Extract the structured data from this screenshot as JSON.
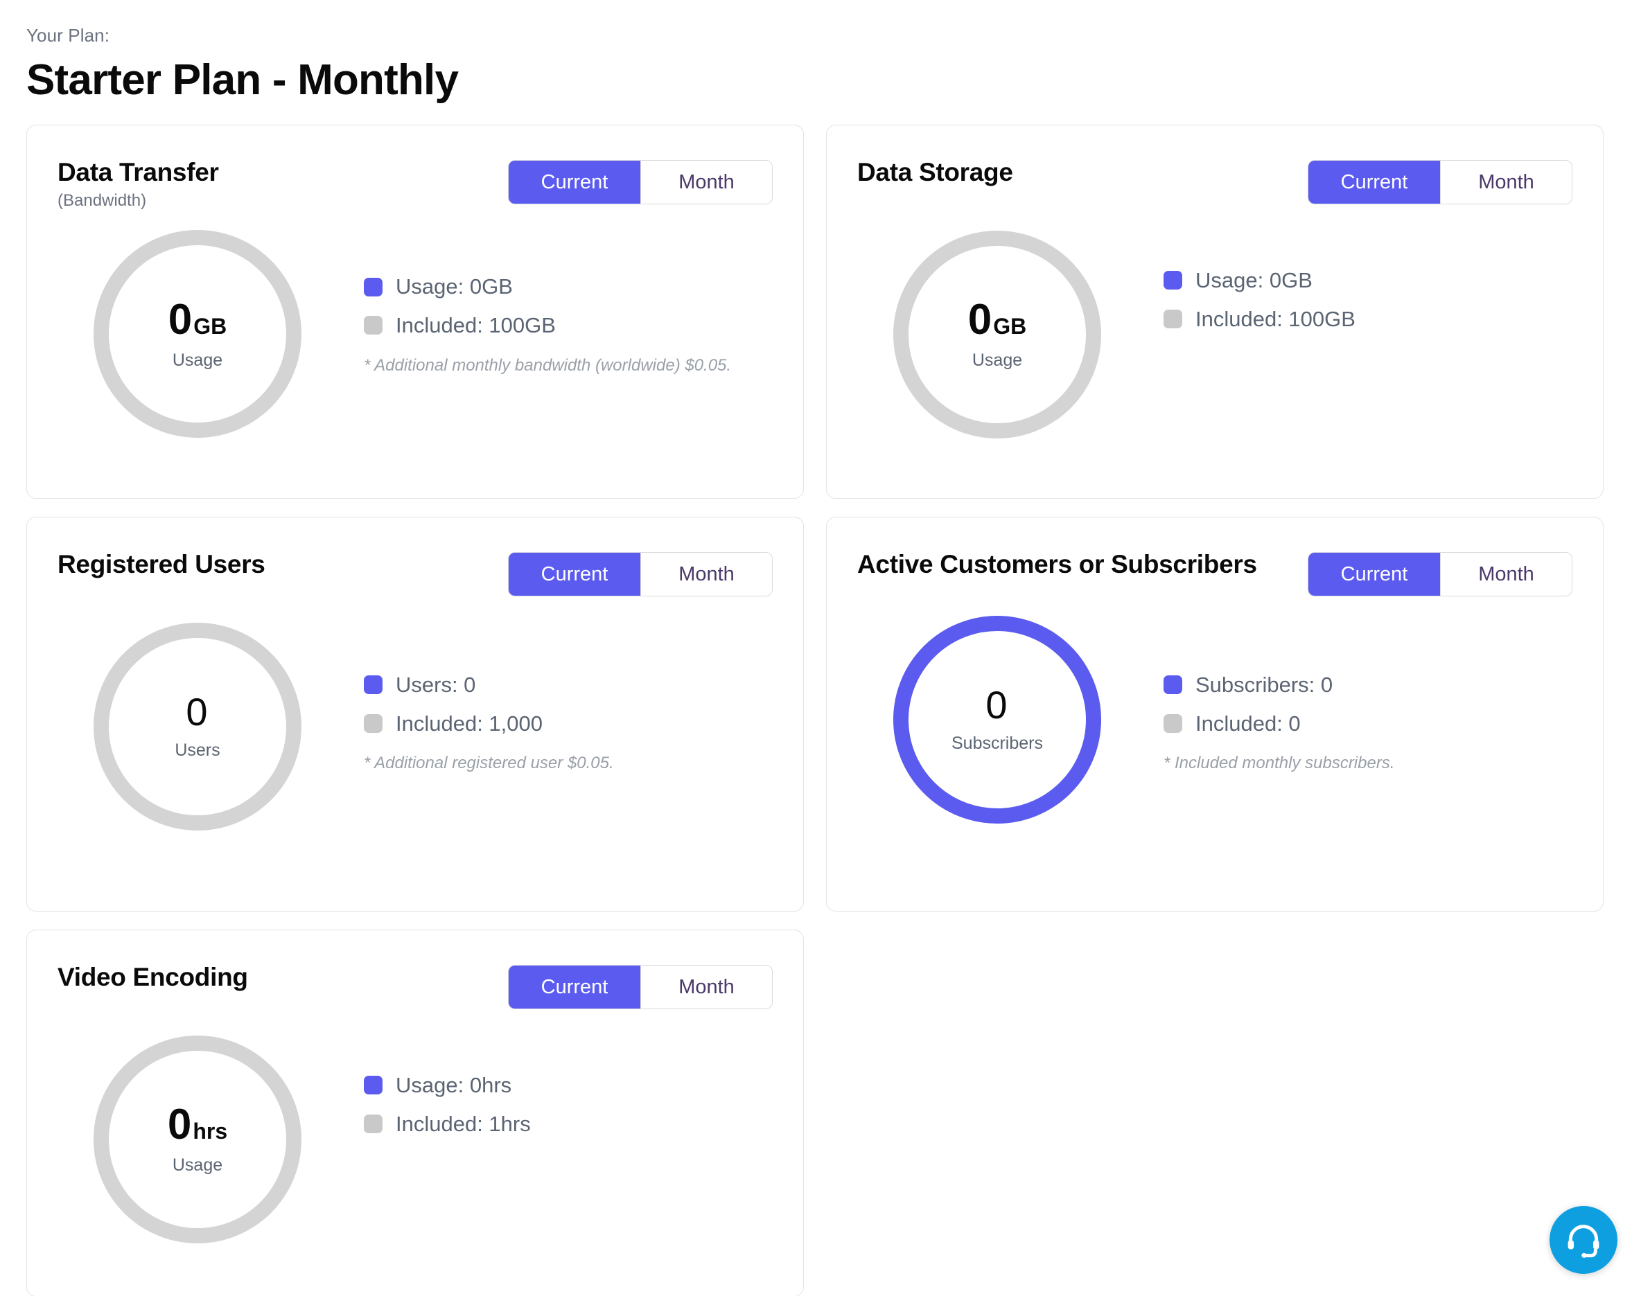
{
  "header": {
    "eyebrow": "Your Plan:",
    "title": "Starter Plan - Monthly"
  },
  "toggle": {
    "current_label": "Current",
    "month_label": "Month"
  },
  "colors": {
    "accent_purple": "#5B5BEF",
    "ring_gray": "#D4D4D4",
    "swatch_gray": "#C9C9C9",
    "support_blue": "#0E9FE0",
    "muted_text": "#5B6472",
    "note_text": "#9AA0A8"
  },
  "cards": [
    {
      "id": "data-transfer",
      "title": "Data Transfer",
      "subtitle": "(Bandwidth)",
      "donut": {
        "value": "0",
        "unit": "GB",
        "label": "Usage",
        "ring_color": "#D4D4D4",
        "percent": 0
      },
      "legend": [
        {
          "swatch": "purple",
          "text": "Usage: 0GB"
        },
        {
          "swatch": "gray",
          "text": "Included: 100GB"
        }
      ],
      "note": "* Additional monthly bandwidth (worldwide) $0.05."
    },
    {
      "id": "data-storage",
      "title": "Data Storage",
      "subtitle": "",
      "donut": {
        "value": "0",
        "unit": "GB",
        "label": "Usage",
        "ring_color": "#D4D4D4",
        "percent": 0
      },
      "legend": [
        {
          "swatch": "purple",
          "text": "Usage: 0GB"
        },
        {
          "swatch": "gray",
          "text": "Included: 100GB"
        }
      ],
      "note": ""
    },
    {
      "id": "registered-users",
      "title": "Registered Users",
      "subtitle": "",
      "donut": {
        "value": "0",
        "unit": "",
        "label": "Users",
        "ring_color": "#D4D4D4",
        "percent": 0
      },
      "legend": [
        {
          "swatch": "purple",
          "text": "Users: 0"
        },
        {
          "swatch": "gray",
          "text": "Included: 1,000"
        }
      ],
      "note": "* Additional registered user $0.05."
    },
    {
      "id": "active-subscribers",
      "title": "Active Customers or Subscribers",
      "subtitle": "",
      "donut": {
        "value": "0",
        "unit": "",
        "label": "Subscribers",
        "ring_color": "#5B5BEF",
        "percent": 100
      },
      "legend": [
        {
          "swatch": "purple",
          "text": "Subscribers: 0"
        },
        {
          "swatch": "gray",
          "text": "Included: 0"
        }
      ],
      "note": "* Included monthly subscribers."
    },
    {
      "id": "video-encoding",
      "title": "Video Encoding",
      "subtitle": "",
      "donut": {
        "value": "0",
        "unit": "hrs",
        "label": "Usage",
        "ring_color": "#D4D4D4",
        "percent": 0
      },
      "legend": [
        {
          "swatch": "purple",
          "text": "Usage: 0hrs"
        },
        {
          "swatch": "gray",
          "text": "Included: 1hrs"
        }
      ],
      "note": ""
    }
  ],
  "support": {
    "icon": "headset-icon"
  }
}
